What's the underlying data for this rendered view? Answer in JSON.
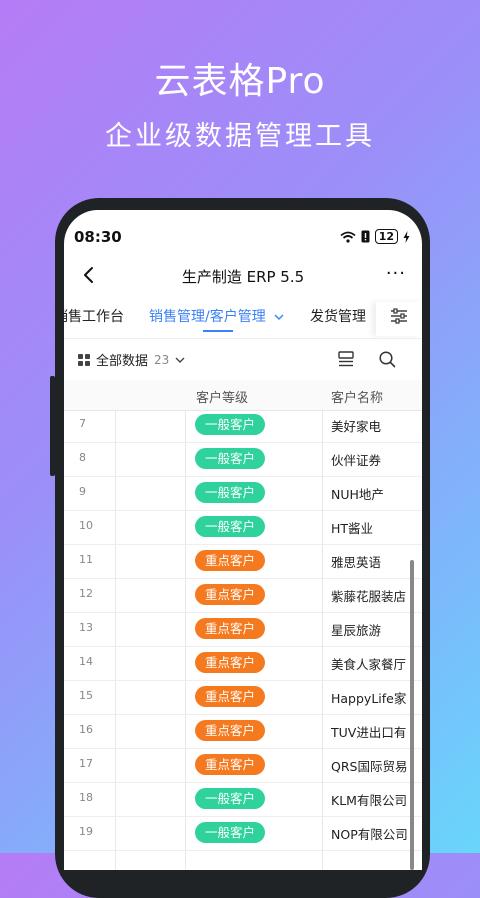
{
  "promo": {
    "title": "云表格Pro",
    "subtitle": "企业级数据管理工具"
  },
  "status_bar": {
    "time": "08:30",
    "battery": "12"
  },
  "nav": {
    "title": "生产制造 ERP 5.5",
    "more": "···"
  },
  "tabs": [
    {
      "label": "销售工作台"
    },
    {
      "label": "销售管理/客户管理",
      "active": true
    },
    {
      "label": "发货管理"
    }
  ],
  "toolbar": {
    "view_label": "全部数据",
    "count": "23"
  },
  "table": {
    "columns": [
      "客户等级",
      "客户名称"
    ],
    "rows": [
      {
        "num": "7",
        "level": "一般客户",
        "name": "美好家电"
      },
      {
        "num": "8",
        "level": "一般客户",
        "name": "伙伴证券"
      },
      {
        "num": "9",
        "level": "一般客户",
        "name": "NUH地产"
      },
      {
        "num": "10",
        "level": "一般客户",
        "name": "HT酱业"
      },
      {
        "num": "11",
        "level": "重点客户",
        "name": "雅思英语"
      },
      {
        "num": "12",
        "level": "重点客户",
        "name": "紫藤花服装店"
      },
      {
        "num": "13",
        "level": "重点客户",
        "name": "星辰旅游"
      },
      {
        "num": "14",
        "level": "重点客户",
        "name": "美食人家餐厅"
      },
      {
        "num": "15",
        "level": "重点客户",
        "name": "HappyLife家"
      },
      {
        "num": "16",
        "level": "重点客户",
        "name": "TUV进出口有"
      },
      {
        "num": "17",
        "level": "重点客户",
        "name": "QRS国际贸易"
      },
      {
        "num": "18",
        "level": "一般客户",
        "name": "KLM有限公司"
      },
      {
        "num": "19",
        "level": "一般客户",
        "name": "NOP有限公司"
      }
    ]
  },
  "colors": {
    "normal_customer": "#2fd29c",
    "key_customer": "#f57a1f",
    "accent": "#3b82f6"
  }
}
